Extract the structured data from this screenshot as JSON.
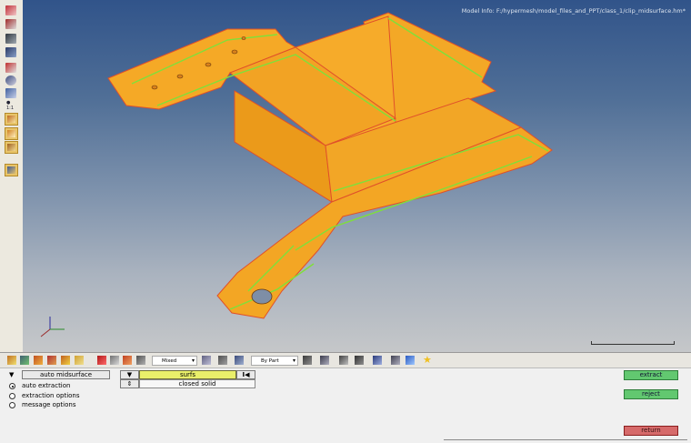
{
  "viewport": {
    "model_info": "Model Info: F:/hypermesh/model_files_and_PPT/class_1/clip_midsurface.hm*"
  },
  "bottom_toolbar": {
    "select_mixed": "Mixed",
    "select_by_part": "By Part"
  },
  "panel": {
    "subpanel_title": "auto midsurface",
    "options": [
      {
        "label": "auto extraction",
        "selected": true
      },
      {
        "label": "extraction options",
        "selected": false
      },
      {
        "label": "message options",
        "selected": false
      }
    ],
    "entity_selector": "surfs",
    "mode_selector": "closed solid",
    "extract_label": "extract",
    "reject_label": "reject",
    "return_label": "return"
  },
  "colors": {
    "model_orange": "#f0a424",
    "edge_green": "#7fe03a",
    "edge_red": "#e0502a",
    "button_green": "#62c870",
    "button_red": "#d66a6a",
    "entity_highlight": "#e9ef6a"
  }
}
